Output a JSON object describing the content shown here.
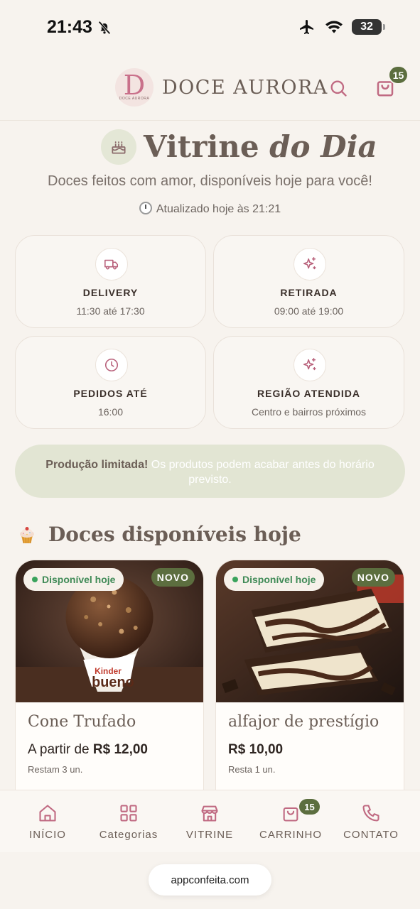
{
  "status_bar": {
    "time": "21:43",
    "battery": "32"
  },
  "header": {
    "brand_name": "DOCE AURORA",
    "logo_letter": "D",
    "logo_mini": "DOCE AURORA",
    "cart_count": "15"
  },
  "hero": {
    "title_main": "Vitrine ",
    "title_italic": "do Dia",
    "subtitle": "Doces feitos com amor, disponíveis hoje para você!",
    "updated": "Atualizado hoje às 21:21"
  },
  "info_cards": [
    {
      "title": "DELIVERY",
      "value": "11:30 até 17:30",
      "icon": "truck-icon"
    },
    {
      "title": "RETIRADA",
      "value": "09:00 até 19:00",
      "icon": "sparkles-icon"
    },
    {
      "title": "PEDIDOS ATÉ",
      "value": "16:00",
      "icon": "clock-icon"
    },
    {
      "title": "REGIÃO ATENDIDA",
      "value": "Centro e bairros próximos",
      "icon": "sparkles-icon"
    }
  ],
  "notice": {
    "strong": "Produção limitada!",
    "text": " Os produtos podem acabar antes do horário previsto."
  },
  "section": {
    "title": "Doces disponíveis hoje",
    "icon": "cupcake-icon"
  },
  "products": [
    {
      "name": "Cone Trufado",
      "price_prefix": "A partir de ",
      "price": "R$ 12,00",
      "stock": "Restam 3 un.",
      "availability": "Disponível hoje",
      "tag": "NOVO"
    },
    {
      "name": "alfajor de prestígio",
      "price_prefix": "",
      "price": "R$ 10,00",
      "stock": "Resta 1 un.",
      "availability": "Disponível hoje",
      "tag": "NOVO"
    }
  ],
  "bottom_nav": {
    "items": [
      {
        "label": "INÍCIO",
        "icon": "home-icon"
      },
      {
        "label": "Categorias",
        "icon": "grid-icon"
      },
      {
        "label": "VITRINE",
        "icon": "store-icon"
      },
      {
        "label": "CARRINHO",
        "icon": "cart-icon"
      },
      {
        "label": "CONTATO",
        "icon": "phone-icon"
      }
    ],
    "cart_count": "15"
  },
  "browser": {
    "url": "appconfeita.com"
  },
  "colors": {
    "accent": "#c9708a",
    "olive": "#5c6e3f",
    "background": "#f7f3ee",
    "text_muted": "#6b5e56"
  }
}
